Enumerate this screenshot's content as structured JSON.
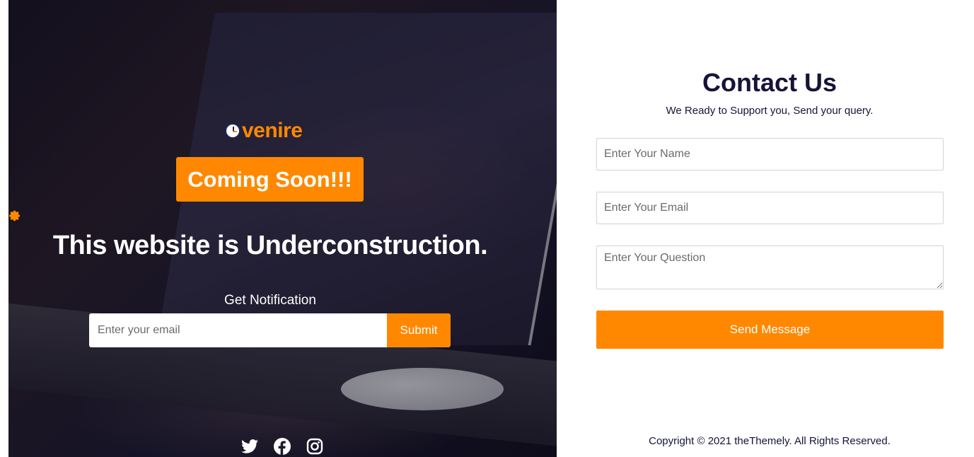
{
  "hero": {
    "logo_text": "venire",
    "badge": "Coming Soon!!!",
    "headline": "This website is Underconstruction.",
    "notify_label": "Get Notification",
    "email_placeholder": "Enter your email",
    "submit_label": "Submit",
    "accent_color": "#ff8800",
    "social_icons": [
      "twitter-icon",
      "facebook-icon",
      "instagram-icon"
    ]
  },
  "contact": {
    "title": "Contact Us",
    "subtitle": "We Ready to Support you, Send your query.",
    "name_placeholder": "Enter Your Name",
    "email_placeholder": "Enter Your Email",
    "question_placeholder": "Enter Your Question",
    "send_label": "Send Message",
    "title_color": "#14143a"
  },
  "footer": {
    "copyright": "Copyright © 2021 theThemely. All Rights Reserved."
  }
}
